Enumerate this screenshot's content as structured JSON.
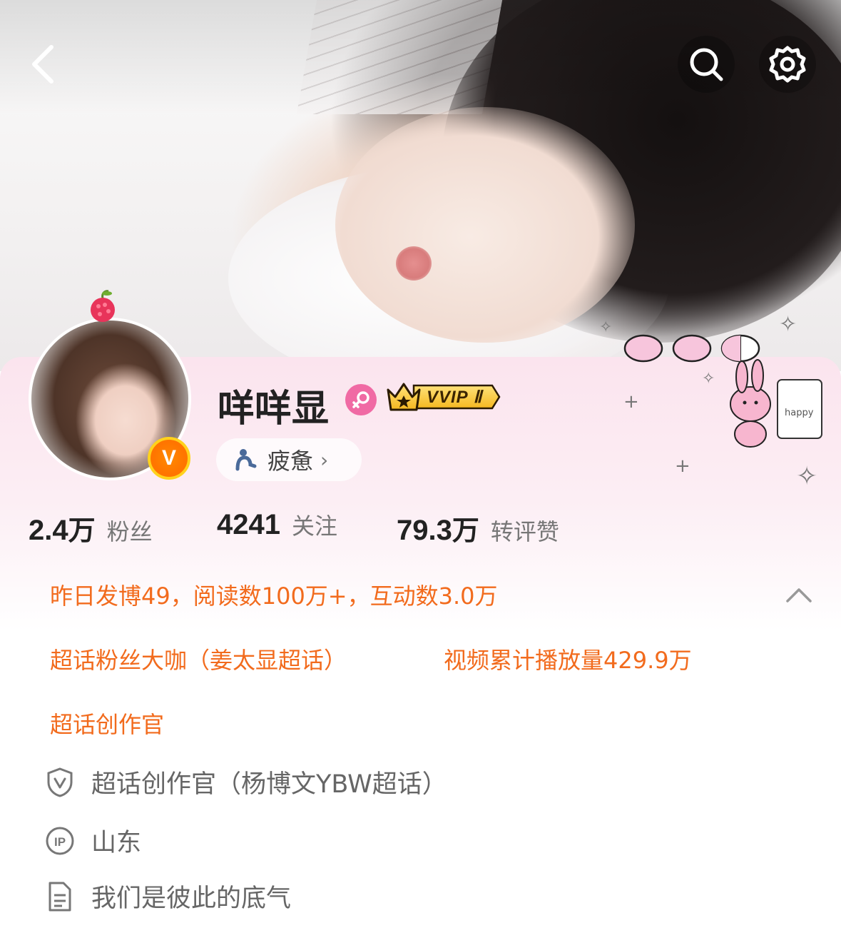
{
  "nav": {
    "back_icon": "chevron-left-icon",
    "search_icon": "search-icon",
    "settings_icon": "gear-icon"
  },
  "profile": {
    "name": "咩咩显",
    "gender_icon": "female-icon",
    "vip_badge": "VVIP Ⅱ",
    "verified_badge": "V",
    "mood": "疲惫"
  },
  "stats": [
    {
      "value": "2.4",
      "unit": "万",
      "label": "粉丝"
    },
    {
      "value": "4241",
      "unit": "",
      "label": "关注"
    },
    {
      "value": "79.3",
      "unit": "万",
      "label": "转评赞"
    }
  ],
  "highlights": {
    "yesterday": "昨日发博49，阅读数100万+，互动数3.0万",
    "supertopic_fan": "超话粉丝大咖（姜太显超话）",
    "video_plays": "视频累计播放量429.9万",
    "supertopic_creator": "超话创作官"
  },
  "info": [
    {
      "icon": "shield-v-icon",
      "text": "超话创作官（杨博文YBW超话）"
    },
    {
      "icon": "ip-icon",
      "text": "山东"
    },
    {
      "icon": "document-icon",
      "text": "我们是彼此的底气"
    }
  ],
  "colors": {
    "accent_orange": "#f26b1d",
    "vip_gold": "#ffc72c",
    "gender_pink": "#f06aa4"
  }
}
